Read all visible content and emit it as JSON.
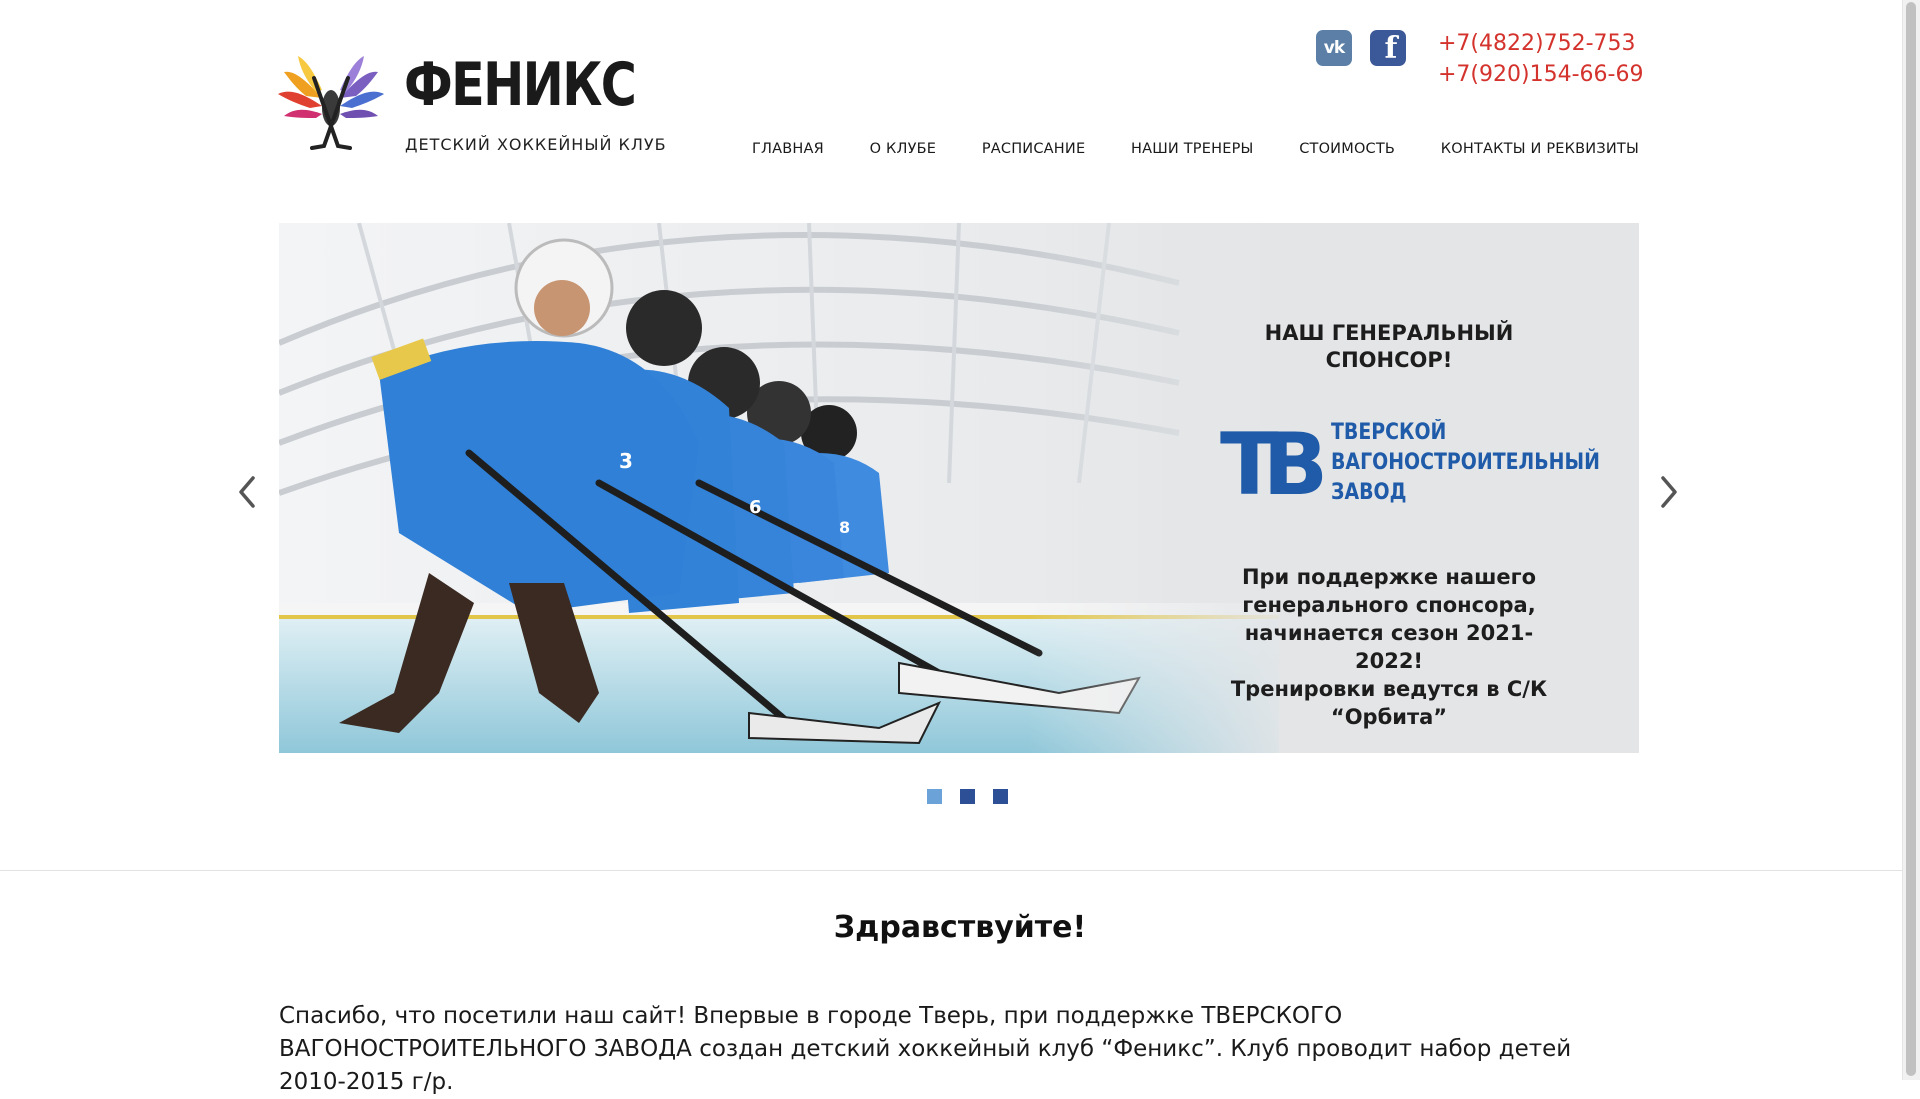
{
  "header": {
    "brand_name": "ФЕНИКС",
    "brand_subtitle": "ДЕТСКИЙ ХОККЕЙНЫЙ КЛУБ",
    "social": [
      {
        "icon": "vk-icon",
        "label": "vk"
      },
      {
        "icon": "facebook-icon",
        "label": "f"
      }
    ],
    "phones": [
      "+7(4822)752-753",
      "+7(920)154-66-69"
    ],
    "accent_color": "#d4322c"
  },
  "nav": [
    {
      "label": "ГЛАВНАЯ"
    },
    {
      "label": "О КЛУБЕ"
    },
    {
      "label": "РАСПИСАНИЕ"
    },
    {
      "label": "НАШИ ТРЕНЕРЫ"
    },
    {
      "label": "СТОИМОСТЬ"
    },
    {
      "label": "КОНТАКТЫ И РЕКВИЗИТЫ"
    }
  ],
  "slider": {
    "sponsor_heading_line1": "НАШ ГЕНЕРАЛЬНЫЙ",
    "sponsor_heading_line2": "СПОНСОР!",
    "sponsor_logo_letters": "ТВ",
    "sponsor_name_line1": "ТВЕРСКОЙ",
    "sponsor_name_line2": "ВАГОНОСТРОИТЕЛЬНЫЙ",
    "sponsor_name_line3": "ЗАВОД",
    "desc_line1": "При поддержке нашего",
    "desc_line2": "генерального спонсора,",
    "desc_line3": "начинается сезон 2021-2022!",
    "desc_line4": "Тренировки ведутся в С/К",
    "desc_line5": "“Орбита”",
    "active_slide": 1,
    "slide_count": 3,
    "jersey_numbers": [
      "3",
      "6",
      "8"
    ]
  },
  "main": {
    "greeting": "Здравствуйте!",
    "intro": "Спасибо, что посетили наш сайт! Впервые в городе Тверь, при поддержке ТВЕРСКОГО ВАГОНОСТРОИТЕЛЬНОГО ЗАВОДА создан детский хоккейный клуб “Феникс”. Клуб проводит набор детей 2010-2015 г/р."
  }
}
